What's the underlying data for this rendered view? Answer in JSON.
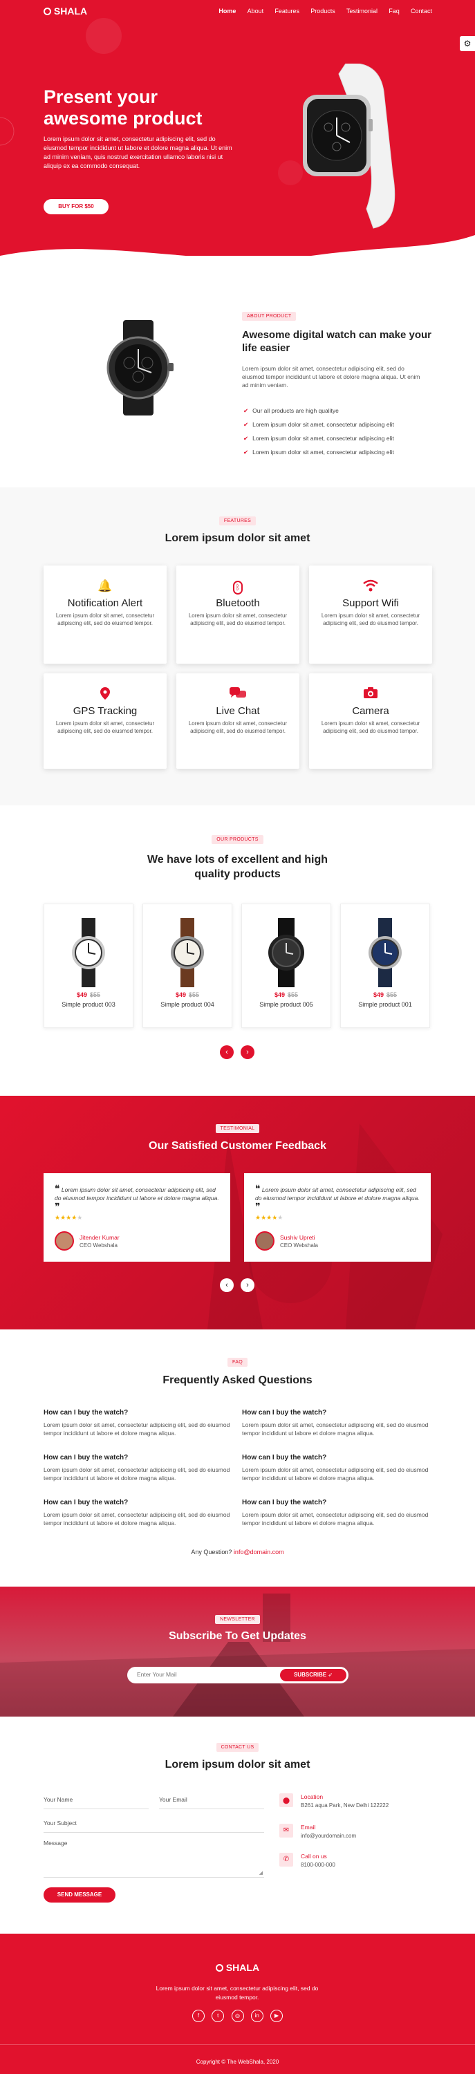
{
  "brand": "SHALA",
  "nav": [
    "Home",
    "About",
    "Features",
    "Products",
    "Testimonial",
    "Faq",
    "Contact"
  ],
  "hero": {
    "title_line1": "Present your",
    "title_line2": "awesome product",
    "text": "Lorem ipsum dolor sit amet, consectetur adipiscing elit, sed do eiusmod tempor incididunt ut labore et dolore magna aliqua. Ut enim ad minim veniam, quis nostrud exercitation ullamco laboris nisi ut aliquip ex ea commodo consequat.",
    "button": "BUY FOR $50"
  },
  "about": {
    "tag": "ABOUT PRODUCT",
    "title": "Awesome digital watch can make your life easier",
    "text": "Lorem ipsum dolor sit amet, consectetur adipiscing elit, sed do eiusmod tempor incididunt ut labore et dolore magna aliqua. Ut enim ad minim veniam.",
    "list": [
      "Our all products are high qualitye",
      "Lorem ipsum dolor sit amet, consectetur adipiscing elit",
      "Lorem ipsum dolor sit amet, consectetur adipiscing elit",
      "Lorem ipsum dolor sit amet, consectetur adipiscing elit"
    ]
  },
  "features": {
    "tag": "FEATURES",
    "title": "Lorem ipsum dolor sit amet",
    "items": [
      {
        "icon": "bell-icon",
        "title": "Notification Alert",
        "desc": "Lorem ipsum dolor sit amet, consectetur adipiscing elit, sed do eiusmod tempor."
      },
      {
        "icon": "bluetooth-icon",
        "title": "Bluetooth",
        "desc": "Lorem ipsum dolor sit amet, consectetur adipiscing elit, sed do eiusmod tempor."
      },
      {
        "icon": "wifi-icon",
        "title": "Support Wifi",
        "desc": "Lorem ipsum dolor sit amet, consectetur adipiscing elit, sed do eiusmod tempor."
      },
      {
        "icon": "map-pin-icon",
        "title": "GPS Tracking",
        "desc": "Lorem ipsum dolor sit amet, consectetur adipiscing elit, sed do eiusmod tempor."
      },
      {
        "icon": "chat-icon",
        "title": "Live Chat",
        "desc": "Lorem ipsum dolor sit amet, consectetur adipiscing elit, sed do eiusmod tempor."
      },
      {
        "icon": "camera-icon",
        "title": "Camera",
        "desc": "Lorem ipsum dolor sit amet, consectetur adipiscing elit, sed do eiusmod tempor."
      }
    ]
  },
  "products": {
    "tag": "OUR PRODUCTS",
    "title_line1": "We have lots of excellent and high",
    "title_line2": "quality products",
    "items": [
      {
        "price": "$49",
        "old": "$55",
        "name": "Simple product 003"
      },
      {
        "price": "$49",
        "old": "$55",
        "name": "Simple product 004"
      },
      {
        "price": "$49",
        "old": "$55",
        "name": "Simple product 005"
      },
      {
        "price": "$49",
        "old": "$55",
        "name": "Simple product 001"
      }
    ]
  },
  "testimonial": {
    "tag": "TESTIMONIAL",
    "title": "Our Satisfied Customer Feedback",
    "items": [
      {
        "quote": "Lorem ipsum dolor sit amet, consectetur adipiscing elit, sed do eiusmod tempor incididunt ut labore et dolore magna aliqua.",
        "name": "Jitender Kumar",
        "role": "CEO Webshala"
      },
      {
        "quote": "Lorem ipsum dolor sit amet, consectetur adipiscing elit, sed do eiusmod tempor incididunt ut labore et dolore magna aliqua.",
        "name": "Sushiv Upreti",
        "role": "CEO Webshala"
      }
    ]
  },
  "faq": {
    "tag": "FAQ",
    "title": "Frequently Asked Questions",
    "items": [
      {
        "q": "How can I buy the watch?",
        "a": "Lorem ipsum dolor sit amet, consectetur adipiscing elit, sed do eiusmod tempor incididunt ut labore et dolore magna aliqua."
      },
      {
        "q": "How can I buy the watch?",
        "a": "Lorem ipsum dolor sit amet, consectetur adipiscing elit, sed do eiusmod tempor incididunt ut labore et dolore magna aliqua."
      },
      {
        "q": "How can I buy the watch?",
        "a": "Lorem ipsum dolor sit amet, consectetur adipiscing elit, sed do eiusmod tempor incididunt ut labore et dolore magna aliqua."
      },
      {
        "q": "How can I buy the watch?",
        "a": "Lorem ipsum dolor sit amet, consectetur adipiscing elit, sed do eiusmod tempor incididunt ut labore et dolore magna aliqua."
      },
      {
        "q": "How can I buy the watch?",
        "a": "Lorem ipsum dolor sit amet, consectetur adipiscing elit, sed do eiusmod tempor incididunt ut labore et dolore magna aliqua."
      },
      {
        "q": "How can I buy the watch?",
        "a": "Lorem ipsum dolor sit amet, consectetur adipiscing elit, sed do eiusmod tempor incididunt ut labore et dolore magna aliqua."
      }
    ],
    "question_text": "Any Question?",
    "email": "info@domain.com"
  },
  "newsletter": {
    "tag": "NEWSLETTER",
    "title": "Subscribe To Get Updates",
    "placeholder": "Enter Your Mail",
    "button": "SUBSCRIBE"
  },
  "contact": {
    "tag": "CONTACT US",
    "title": "Lorem ipsum dolor sit amet",
    "name_placeholder": "Your Name",
    "email_placeholder": "Your Email",
    "subject_placeholder": "Your Subject",
    "message_placeholder": "Message",
    "button": "SEND MESSAGE",
    "location_label": "Location",
    "location_value": "B261 aqua Park, New Delhi 122222",
    "email_label": "Email",
    "email_value": "info@yourdomain.com",
    "call_label": "Call on us",
    "call_value": "8100-000-000"
  },
  "footer": {
    "brand": "SHALA",
    "text": "Lorem ipsum dolor sit amet, consectetur adipiscing elit, sed do eiusmod tempor.",
    "copyright": "Copyright © The WebShala, 2020"
  },
  "colors": {
    "accent": "#e1122d",
    "dark": "#222222"
  }
}
